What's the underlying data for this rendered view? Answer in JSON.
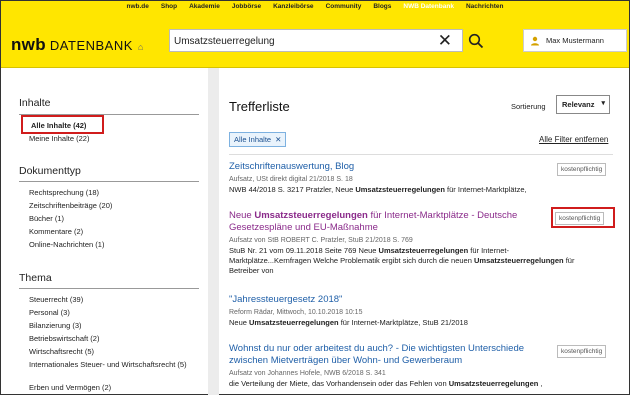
{
  "topnav": [
    "nwb.de",
    "Shop",
    "Akademie",
    "Jobbörse",
    "Kanzleibörse",
    "Community",
    "Blogs",
    "NWB Datenbank",
    "Nachrichten"
  ],
  "logo": {
    "brand": "nwb",
    "product": "DATENBANK",
    "home_icon": "home-icon"
  },
  "search": {
    "value": "Umsatzsteuerregelung"
  },
  "user": {
    "name": "Max Mustermann"
  },
  "sidebar": {
    "inhalte_heading": "Inhalte",
    "inhalte": [
      "Alle Inhalte (42)",
      "Meine Inhalte (22)"
    ],
    "dokumenttyp_heading": "Dokumenttyp",
    "dokumenttyp": [
      "Rechtsprechung (18)",
      "Zeitschriftenbeiträge (20)",
      "Bücher (1)",
      "Kommentare (2)",
      "Online-Nachrichten (1)"
    ],
    "thema_heading": "Thema",
    "thema": [
      "Steuerrecht (39)",
      "Personal (3)",
      "Bilanzierung (3)",
      "Betriebswirtschaft (2)",
      "Wirtschaftsrecht (5)",
      "Internationales Steuer- und Wirtschaftsrecht (5)",
      "Erben und Vermögen (2)"
    ]
  },
  "main": {
    "title": "Trefferliste",
    "sort_label": "Sortierung",
    "sort_value": "Relevanz",
    "filter_chip": "Alle Inhalte",
    "all_filters": "Alle Filter entfernen",
    "badge": "kostenpflichtig",
    "results": [
      {
        "title": "Zeitschriftenauswertung, Blog",
        "meta": "Aufsatz, USt direkt digital 21/2018 S. 18",
        "text_pre": "NWB 44/2018 S. 3217 Pratzler, Neue ",
        "text_bold": "Umsatzsteuerregelungen",
        "text_post": " für Internet-Marktplätze,"
      },
      {
        "title_pre": "Neue ",
        "title_bold": "Umsatzsteuerregelungen",
        "title_post": " für Internet-Marktplätze - Deutsche Gesetzespläne und EU-Maßnahme",
        "meta": "Aufsatz von StB ROBERT C. Pratzler, StuB 21/2018 S. 769",
        "line1_pre": "StuB Nr. 21 vom 09.11.2018 Seite 769 Neue ",
        "line1_bold": "Umsatzsteuerregelungen",
        "line1_post": " für Internet-",
        "line2_pre": "Marktplätze...Kernfragen Welche Problematik ergibt sich durch die neuen ",
        "line2_bold": "Umsatzsteuerregelungen",
        "line2_post": " für",
        "line3": "Betreiber von"
      },
      {
        "title": "\"Jahressteuergesetz 2018\"",
        "meta": "Reform Rädar, Mittwoch, 10.10.2018 10:15",
        "text_pre": "Neue ",
        "text_bold": "Umsatzsteuerregelungen",
        "text_post": " für Internet-Marktplätze, StuB 21/2018"
      },
      {
        "title": "Wohnst du nur oder arbeitest du auch? - Die wichtigsten Unterschiede zwischen Mietverträgen über Wohn- und Gewerberaum",
        "meta": "Aufsatz von Johannes Hofele, NWB 6/2018 S. 341",
        "text_pre": "die Verteilung der Miete, das Vorhandensein oder das Fehlen von ",
        "text_bold": "Umsatzsteuerregelungen",
        "text_post": " ,"
      }
    ]
  },
  "colors": {
    "brand_yellow": "#ffe600",
    "highlight_red": "#d01c1c",
    "link_blue": "#1f5fa8",
    "visited_purple": "#8a2a8a"
  }
}
